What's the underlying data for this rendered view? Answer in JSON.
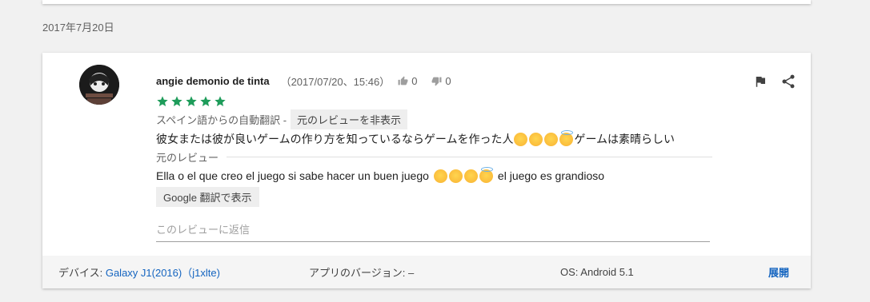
{
  "date_header": "2017年7月20日",
  "review": {
    "author": "angie demonio de tinta",
    "timestamp": "（2017/07/20、15:46）",
    "thumbs_up_count": "0",
    "thumbs_down_count": "0",
    "rating": 5,
    "translate_notice": "スペイン語からの自動翻訳 -",
    "hide_original_label": "元のレビューを非表示",
    "translated_text_before_emoji": "彼女または彼が良いゲームの作り方を知っているならゲームを作った人",
    "translated_text_after_emoji": "ゲームは素晴らしい",
    "original_label": "元のレビュー",
    "original_text_before_emoji": "Ella o el que creo el juego si sabe hacer un buen juego",
    "original_text_after_emoji": "el juego es grandioso",
    "google_translate_label": "Google 翻訳で表示",
    "reply_placeholder": "このレビューに返信"
  },
  "footer": {
    "device_label": "デバイス: ",
    "device_value": "Galaxy J1(2016)（j1xlte)",
    "app_version": "アプリのバージョン: –",
    "os": "OS: Android 5.1",
    "expand": "展開"
  },
  "colors": {
    "star": "#1e9c5a",
    "link": "#1565c0"
  }
}
